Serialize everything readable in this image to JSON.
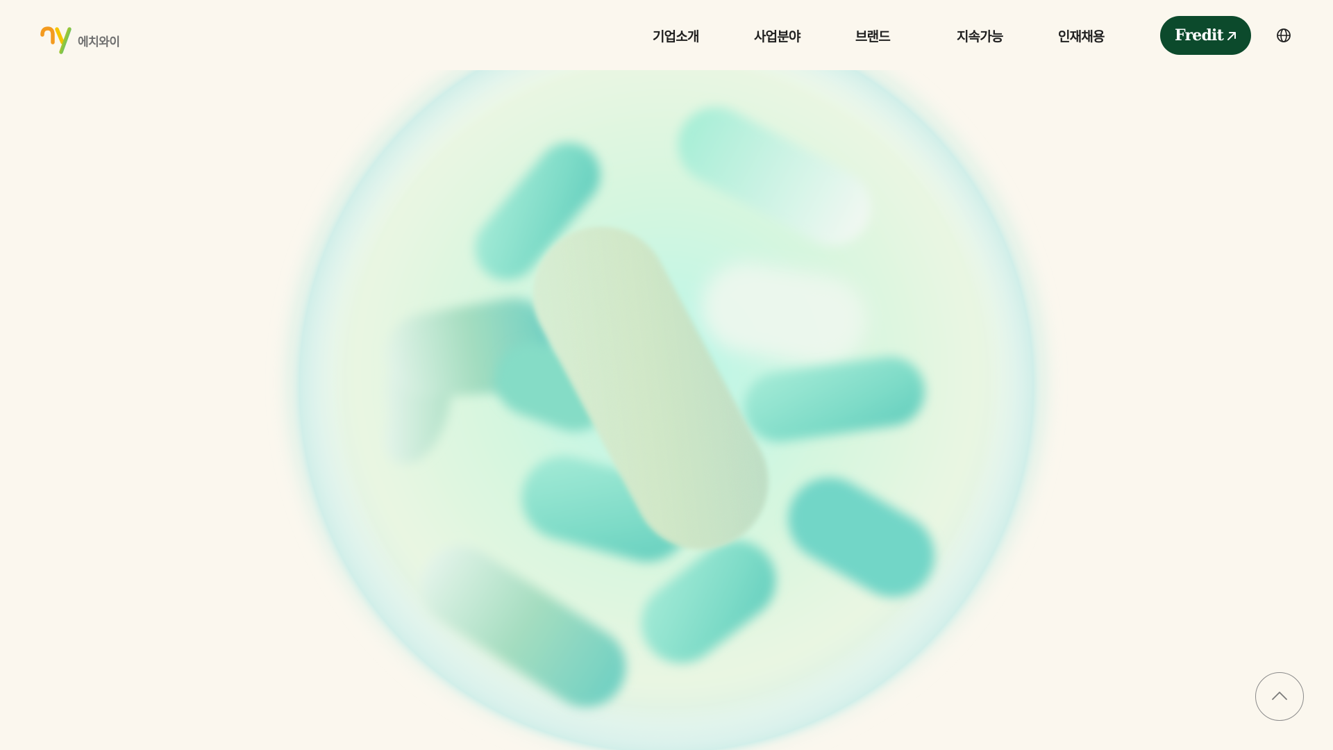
{
  "header": {
    "logo": {
      "mark": "hy",
      "text": "에치와이"
    },
    "nav": {
      "items": [
        {
          "label": "기업소개"
        },
        {
          "label": "사업분야"
        },
        {
          "label": "브랜드"
        },
        {
          "label": "지속가능"
        },
        {
          "label": "인재채용"
        }
      ]
    },
    "fredit_button": {
      "label": "Fredit",
      "icon": "arrow-up-right-icon"
    },
    "language_icon": "globe-icon"
  },
  "hero": {
    "image": "probiotic-bacteria-sphere"
  },
  "scroll_top": {
    "icon": "chevron-up-icon"
  },
  "colors": {
    "background": "#fbf7ee",
    "brand_green": "#0c4a2c",
    "logo_red": "#e8454a",
    "logo_orange": "#f39a1e",
    "logo_yellow": "#f5c400",
    "logo_cyan": "#21b3c9",
    "bacteria_teal": "#72d9c8"
  }
}
